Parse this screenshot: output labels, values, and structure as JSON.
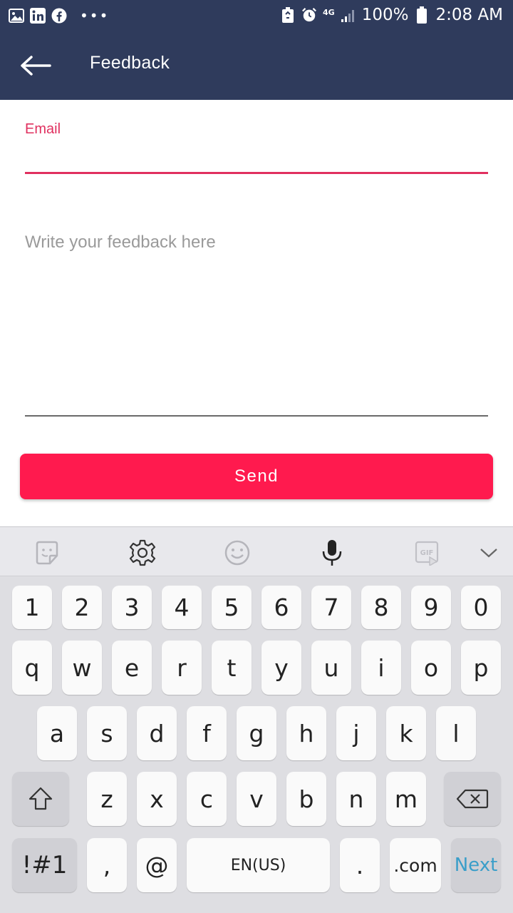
{
  "status_bar": {
    "battery": "100%",
    "time": "2:08 AM",
    "network": "4G",
    "left_icons": [
      "gallery-icon",
      "linkedin-icon",
      "facebook-icon",
      "more-dots-icon"
    ],
    "right_icons": [
      "battery-saver-icon",
      "alarm-icon",
      "network-4g-icon",
      "signal-icon",
      "battery-icon"
    ]
  },
  "app_bar": {
    "title": "Feedback",
    "back_icon": "arrow-left-icon",
    "color": "#2f3b5c"
  },
  "form": {
    "email_label": "Email",
    "email_value": "",
    "feedback_placeholder": "Write your feedback here",
    "feedback_value": "",
    "send_label": "Send",
    "accent_color": "#e0305f",
    "button_color": "#ff1a4e"
  },
  "keyboard": {
    "toolbar_icons": [
      "sticker-icon",
      "settings-icon",
      "emoji-icon",
      "microphone-icon",
      "gif-icon",
      "chevron-down-icon"
    ],
    "numbers": [
      "1",
      "2",
      "3",
      "4",
      "5",
      "6",
      "7",
      "8",
      "9",
      "0"
    ],
    "row1": [
      "q",
      "w",
      "e",
      "r",
      "t",
      "y",
      "u",
      "i",
      "o",
      "p"
    ],
    "row2": [
      "a",
      "s",
      "d",
      "f",
      "g",
      "h",
      "j",
      "k",
      "l"
    ],
    "row3": [
      "z",
      "x",
      "c",
      "v",
      "b",
      "n",
      "m"
    ],
    "symbols_label": "!#1",
    "comma": ",",
    "at": "@",
    "space_label": "EN(US)",
    "period": ".",
    "dotcom": ".com",
    "next_label": "Next",
    "next_color": "#3a9ec9"
  }
}
